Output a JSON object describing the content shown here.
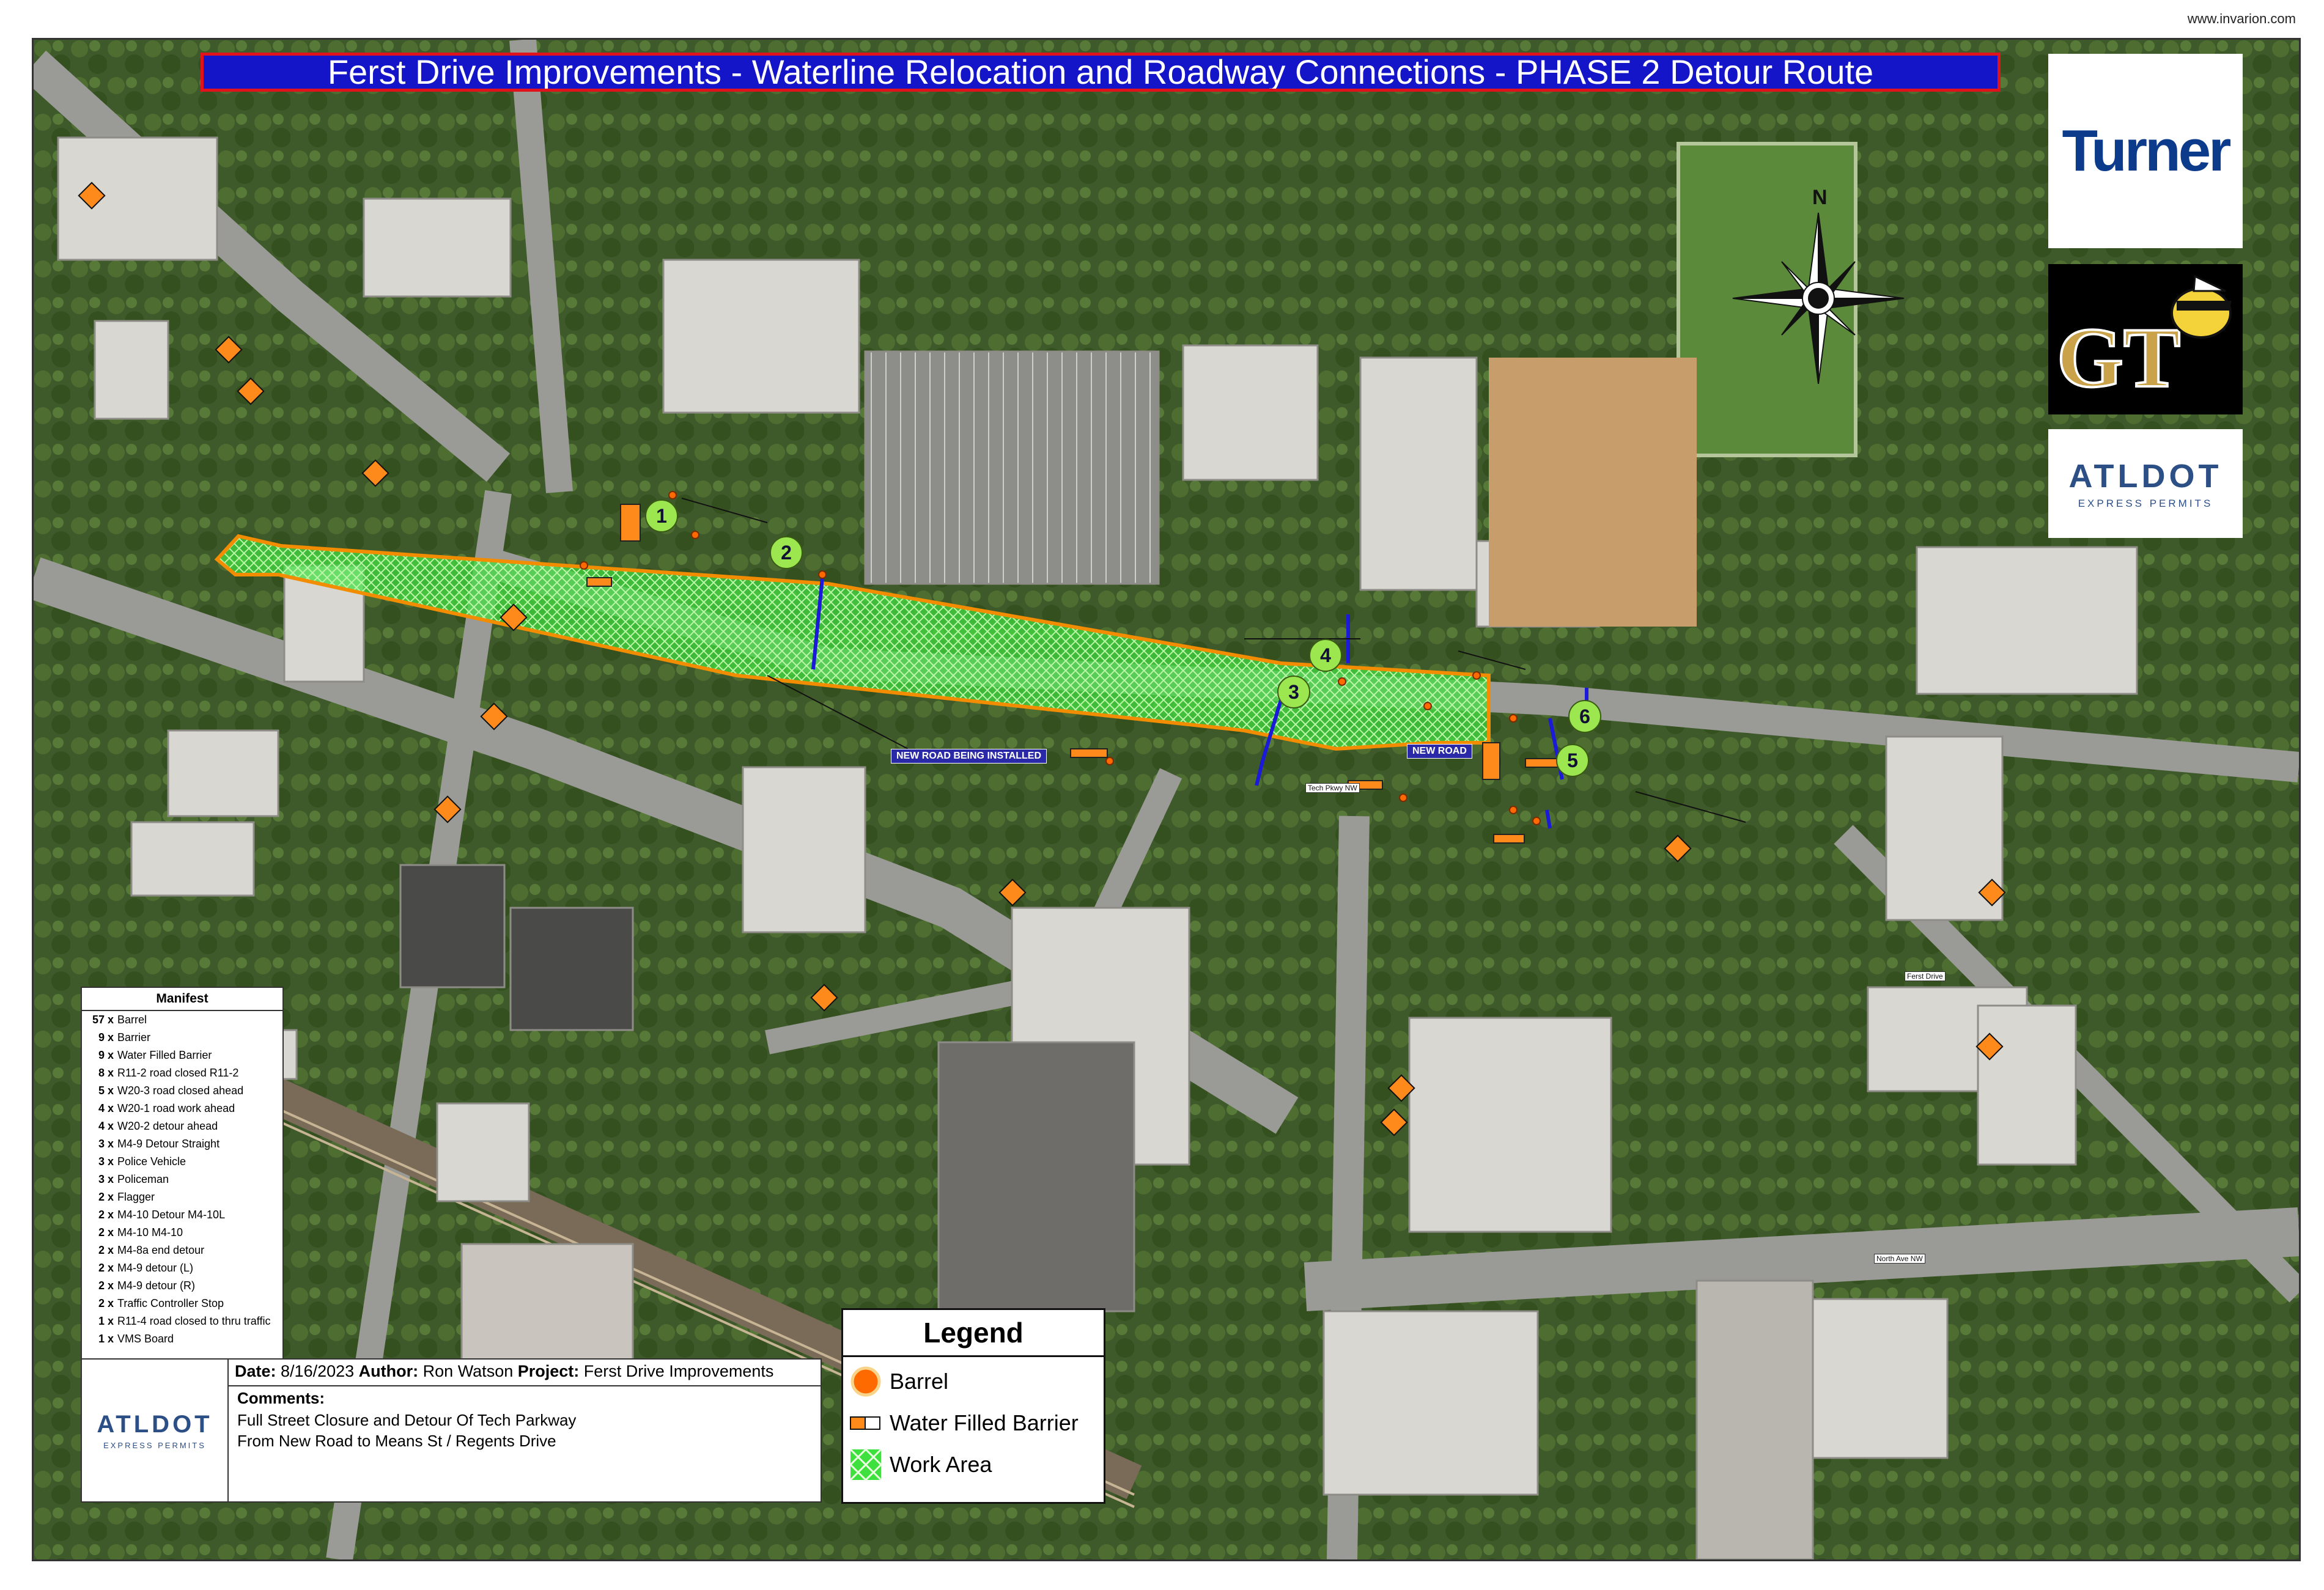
{
  "credit": "www.invarion.com",
  "title": "Ferst Drive Improvements - Waterline Relocation and Roadway Connections - PHASE 2 Detour Route",
  "logos": {
    "turner": "Turner",
    "gt": "GT",
    "atldot_name": "ATLDOT",
    "atldot_sub": "EXPRESS PERMITS"
  },
  "compass": {
    "north_label": "N"
  },
  "map_labels": {
    "new_road_being_installed": "NEW ROAD BEING INSTALLED",
    "new_road": "NEW ROAD",
    "ferst_drive": "Ferst Drive",
    "north_ave": "North Ave NW",
    "tech_pkwy": "Tech Pkwy NW"
  },
  "markers": [
    "1",
    "2",
    "3",
    "4",
    "5",
    "6"
  ],
  "manifest": {
    "title": "Manifest",
    "items": [
      {
        "qty": "57 x",
        "name": "Barrel"
      },
      {
        "qty": "9 x",
        "name": "Barrier"
      },
      {
        "qty": "9 x",
        "name": "Water Filled Barrier"
      },
      {
        "qty": "8 x",
        "name": "R11-2 road closed R11-2"
      },
      {
        "qty": "5 x",
        "name": "W20-3 road closed ahead"
      },
      {
        "qty": "4 x",
        "name": "W20-1 road work ahead"
      },
      {
        "qty": "4 x",
        "name": "W20-2 detour ahead"
      },
      {
        "qty": "3 x",
        "name": "M4-9 Detour Straight"
      },
      {
        "qty": "3 x",
        "name": "Police Vehicle"
      },
      {
        "qty": "3 x",
        "name": "Policeman"
      },
      {
        "qty": "2 x",
        "name": "Flagger"
      },
      {
        "qty": "2 x",
        "name": "M4-10 Detour M4-10L"
      },
      {
        "qty": "2 x",
        "name": "M4-10 M4-10"
      },
      {
        "qty": "2 x",
        "name": "M4-8a end detour"
      },
      {
        "qty": "2 x",
        "name": "M4-9 detour (L)"
      },
      {
        "qty": "2 x",
        "name": "M4-9 detour (R)"
      },
      {
        "qty": "2 x",
        "name": "Traffic Controller Stop"
      },
      {
        "qty": "1 x",
        "name": "R11-4 road closed to thru traffic"
      },
      {
        "qty": "1 x",
        "name": "VMS Board"
      }
    ]
  },
  "info": {
    "date_label": "Date:",
    "date": "8/16/2023",
    "author_label": "Author:",
    "author": "Ron Watson",
    "project_label": "Project:",
    "project": "Ferst Drive Improvements",
    "comments_label": "Comments:",
    "comment_line1": "Full Street Closure and Detour Of Tech Parkway",
    "comment_line2": "From New Road to Means St / Regents Drive"
  },
  "legend": {
    "title": "Legend",
    "items": [
      {
        "label": "Barrel",
        "symbol": "barrel-icon"
      },
      {
        "label": "Water Filled Barrier",
        "symbol": "water-barrier-icon"
      },
      {
        "label": "Work Area",
        "symbol": "work-area-icon"
      }
    ]
  },
  "colors": {
    "title_bg": "#1414c8",
    "title_border": "#e0121c",
    "work_area": "#3ee03e",
    "work_area_border": "#f28c00",
    "barrel": "#ff6a00",
    "marker": "#9ce650",
    "detour_line": "#1a1ad8"
  }
}
